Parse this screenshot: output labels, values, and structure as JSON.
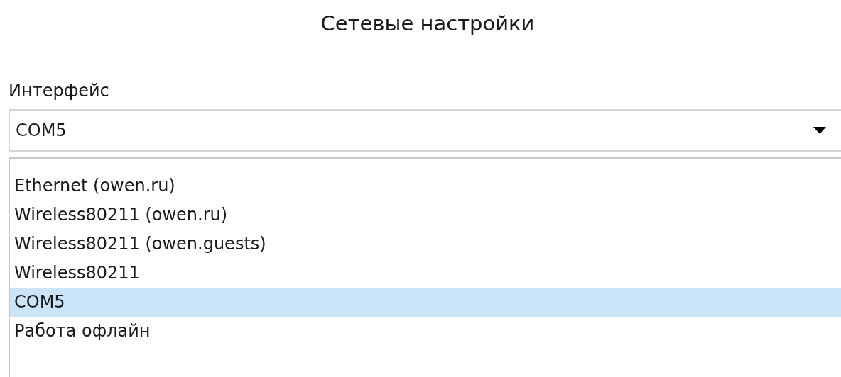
{
  "window": {
    "title": "Сетевые настройки"
  },
  "interface": {
    "label": "Интерфейс",
    "value": "COM5",
    "expanded": true,
    "options": [
      {
        "label": "Ethernet (owen.ru)",
        "selected": false
      },
      {
        "label": "Wireless80211 (owen.ru)",
        "selected": false
      },
      {
        "label": "Wireless80211 (owen.guests)",
        "selected": false
      },
      {
        "label": "Wireless80211",
        "selected": false
      },
      {
        "label": "COM5",
        "selected": true
      },
      {
        "label": "Работа офлайн",
        "selected": false
      }
    ]
  }
}
